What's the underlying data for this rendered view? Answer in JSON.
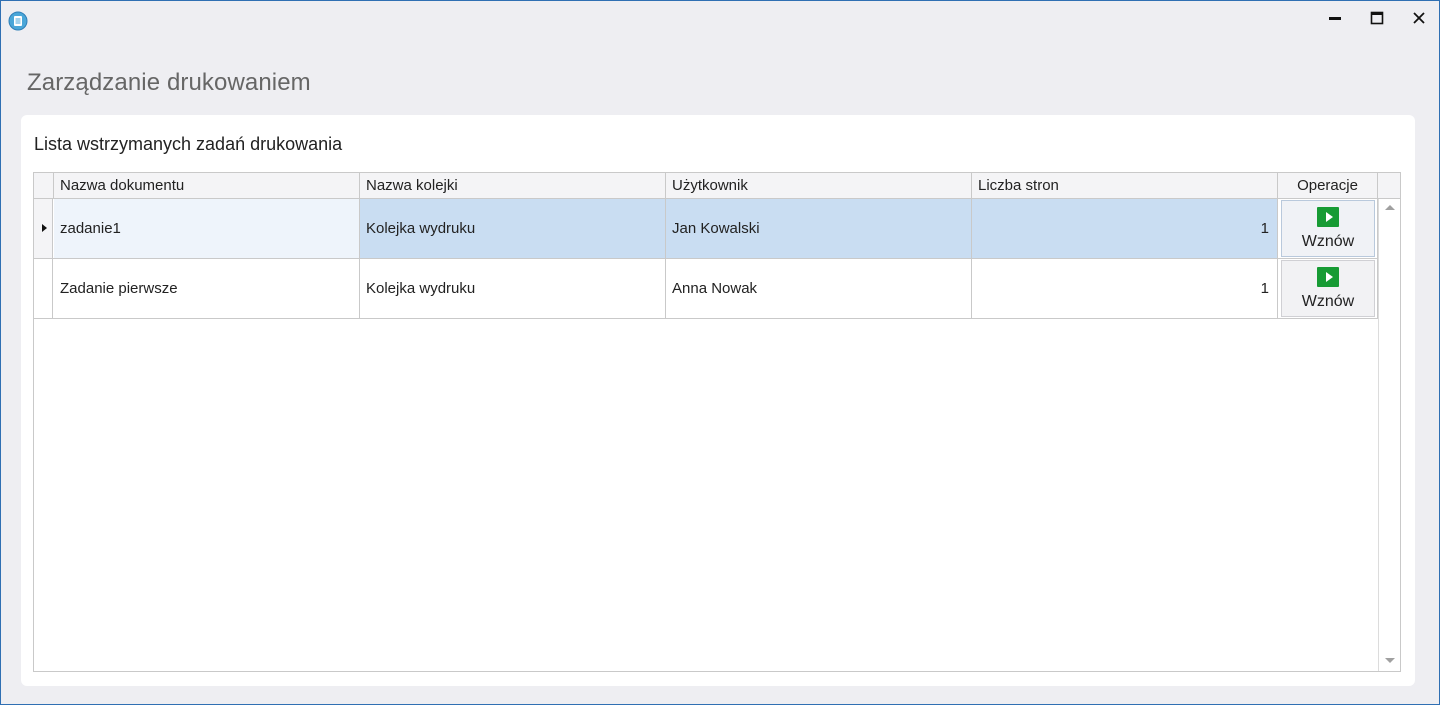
{
  "window": {
    "icon": "printer-queue-icon",
    "controls": {
      "minimize": "minimize-icon",
      "maximize": "maximize-icon",
      "close": "close-icon"
    }
  },
  "page": {
    "title": "Zarządzanie drukowaniem"
  },
  "panel": {
    "title": "Lista wstrzymanych zadań drukowania"
  },
  "grid": {
    "columns": [
      "Nazwa dokumentu",
      "Nazwa kolejki",
      "Użytkownik",
      "Liczba stron",
      "Operacje"
    ],
    "rows": [
      {
        "document": "zadanie1",
        "queue": "Kolejka wydruku",
        "user": "Jan Kowalski",
        "pages": "1",
        "action": "Wznów",
        "selected": true
      },
      {
        "document": "Zadanie pierwsze",
        "queue": "Kolejka wydruku",
        "user": "Anna Nowak",
        "pages": "1",
        "action": "Wznów",
        "selected": false
      }
    ]
  },
  "colors": {
    "accent": "#2f6fb3",
    "selection": "#c9ddf2",
    "play": "#179b34"
  }
}
